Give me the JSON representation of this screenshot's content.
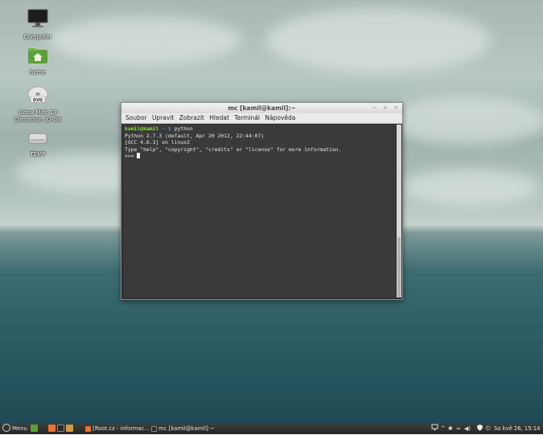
{
  "desktop": {
    "icons": [
      {
        "label": "Computer",
        "icon": "monitor-icon"
      },
      {
        "label": "home",
        "icon": "home-folder-icon"
      },
      {
        "label": "Linux Mint 13\nCinnamon 32-bit",
        "icon": "dvd-icon"
      },
      {
        "label": "TEMP",
        "icon": "drive-icon"
      }
    ]
  },
  "window": {
    "title": "mc [kamil@kamil]:~",
    "controls": [
      "−",
      "+",
      "×"
    ],
    "menu": [
      "Soubor",
      "Upravit",
      "Zobrazit",
      "Hledat",
      "Terminál",
      "Nápověda"
    ]
  },
  "terminal": {
    "prompt_user": "kamil@kamil",
    "prompt_path": "~ $",
    "command": "python",
    "output": [
      "Python 2.7.3 (default, Apr 20 2012, 22:44:07)",
      "[GCC 4.6.3] on linux2",
      "Type \"help\", \"copyright\", \"credits\" or \"license\" for more information."
    ],
    "repl_prompt": ">>>"
  },
  "taskbar": {
    "menu_label": "Menu",
    "tasks": [
      "[Root.cz - informac...",
      "mc [kamil@kamil]:~"
    ],
    "clock": "So kvě 26, 15:14"
  },
  "colors": {
    "prompt_user": "#8ae234",
    "prompt_path": "#729fcf",
    "terminal_bg": "#3a3a3a"
  }
}
